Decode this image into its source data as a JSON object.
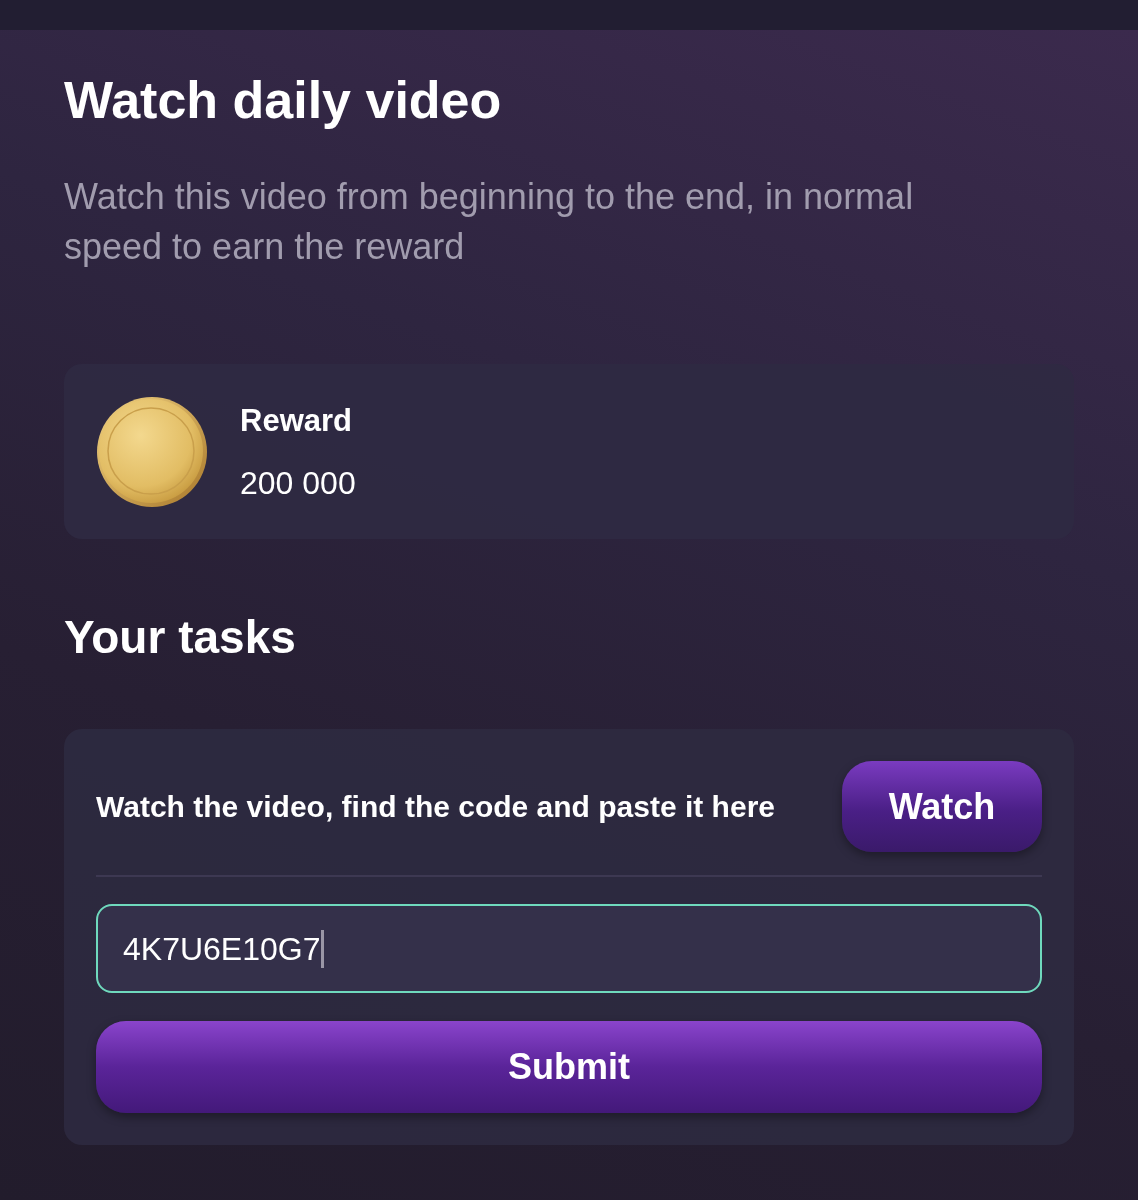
{
  "page": {
    "title": "Watch daily video",
    "description": "Watch this video from beginning to the end, in normal speed to earn the reward"
  },
  "reward": {
    "label": "Reward",
    "amount": "200 000"
  },
  "tasks": {
    "heading": "Your tasks",
    "items": [
      {
        "instruction": "Watch the video, find the code and paste it here",
        "watch_button": "Watch",
        "code_field": {
          "value": "4K7U6E10G7",
          "focused": true
        },
        "submit_button": "Submit"
      }
    ]
  }
}
